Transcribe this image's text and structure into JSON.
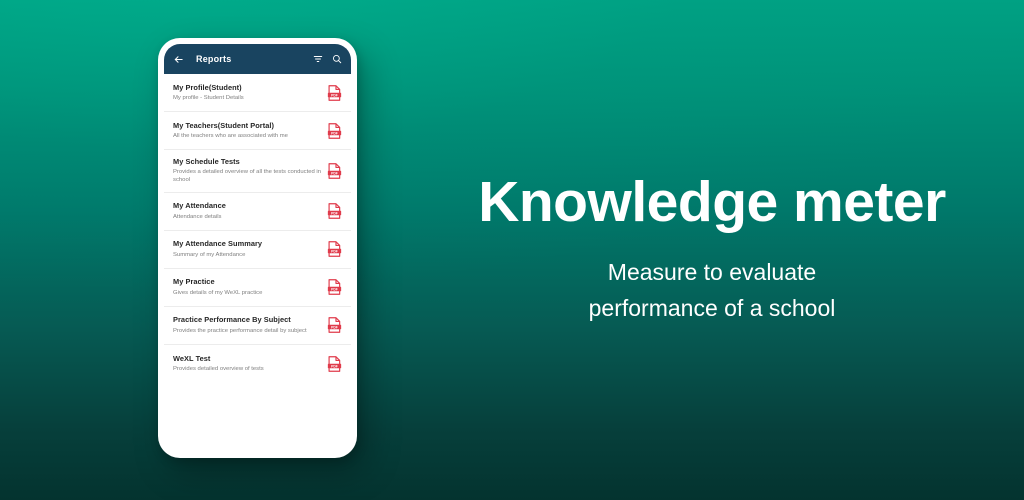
{
  "background": {
    "gradient_top": "#00A183",
    "gradient_bottom": "#04332F"
  },
  "phone": {
    "appbar": {
      "title": "Reports",
      "accent": "#194460",
      "back_icon": "arrow-left-icon",
      "filter_icon": "filter-icon",
      "search_icon": "search-icon"
    },
    "list": {
      "item_icon": "pdf-file-icon",
      "icon_color": "#E03B4B",
      "items": [
        {
          "title": "My Profile(Student)",
          "subtitle": "My profile - Student Details"
        },
        {
          "title": "My Teachers(Student Portal)",
          "subtitle": "All the teachers who are associated with me"
        },
        {
          "title": "My Schedule Tests",
          "subtitle": "Provides a detailed overview of all the tests conducted in school"
        },
        {
          "title": "My Attendance",
          "subtitle": "Attendance details"
        },
        {
          "title": "My Attendance Summary",
          "subtitle": "Summary of my Attendance"
        },
        {
          "title": "My Practice",
          "subtitle": "Gives details of my WeXL practice"
        },
        {
          "title": "Practice Performance By Subject",
          "subtitle": "Provides the practice performance detail by subject"
        },
        {
          "title": "WeXL Test",
          "subtitle": "Provides detailed overview of tests"
        }
      ]
    }
  },
  "hero": {
    "headline": "Knowledge meter",
    "subtitle_line1": "Measure to evaluate",
    "subtitle_line2": "performance of a school"
  }
}
